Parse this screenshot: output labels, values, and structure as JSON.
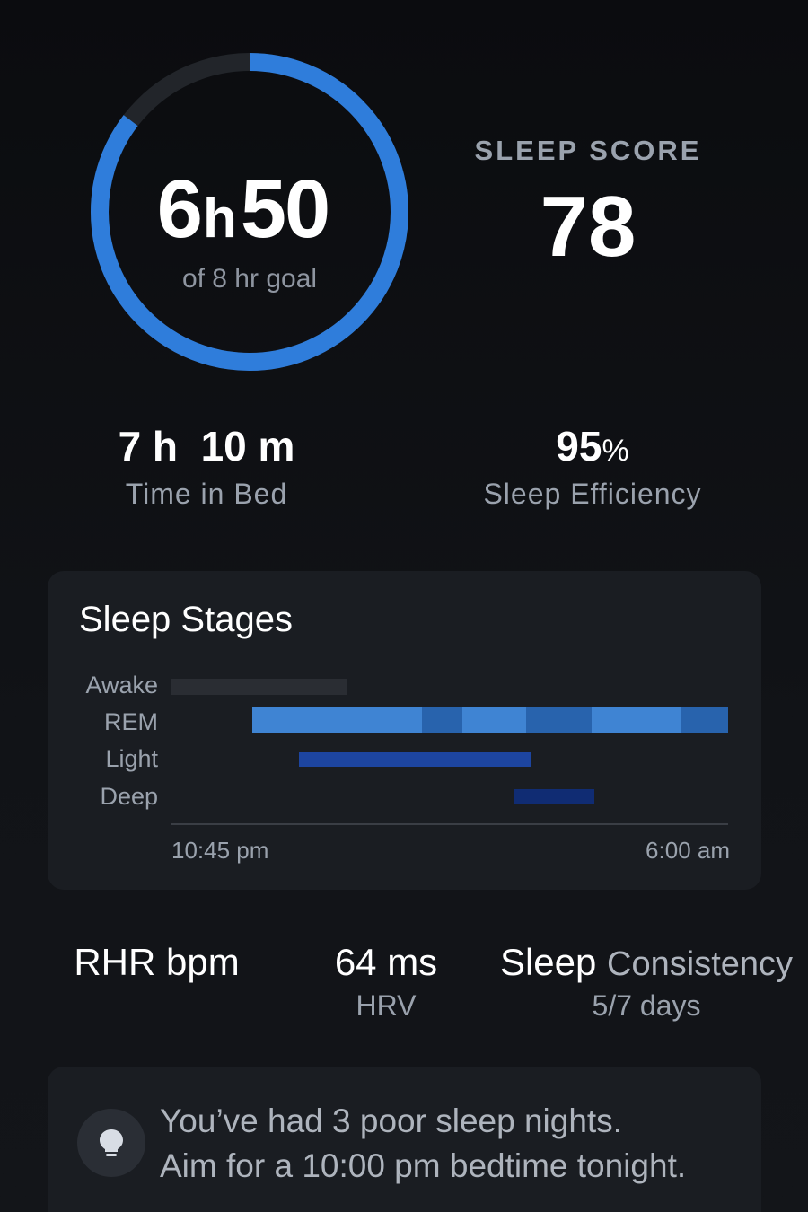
{
  "colors": {
    "accent": "#2f7ddb",
    "ring_track": "#22252a",
    "card_bg": "#1a1d22",
    "awake": "#2a2d33",
    "rem_light": "#3f84d3",
    "rem_dark": "#2863ad",
    "light": "#1d45a0",
    "deep": "#102c73"
  },
  "sleep_ring": {
    "hours": "6",
    "hours_unit": "h",
    "minutes": "50",
    "goal_text": "of 8 hr goal",
    "goal_progress": 0.854
  },
  "sleep_score": {
    "label": "SLEEP SCORE",
    "value": "78"
  },
  "time_in_bed": {
    "value": "7 h  10 m",
    "label": "Time in Bed"
  },
  "sleep_efficiency": {
    "value": "95",
    "unit": "%",
    "label": "Sleep Efficiency"
  },
  "stages_card": {
    "title": "Sleep Stages",
    "start_time": "10:45 pm",
    "end_time": "6:00 am",
    "labels": [
      "Awake",
      "REM",
      "Light",
      "Deep"
    ]
  },
  "chart_data": {
    "type": "timeline",
    "x_range": [
      "10:45 pm",
      "6:00 am"
    ],
    "stages": [
      {
        "name": "Awake",
        "segments": [
          [
            0.0,
            0.315
          ]
        ],
        "color": "#2a2d33"
      },
      {
        "name": "REM",
        "segments": [
          [
            0.145,
            0.45
          ],
          [
            0.45,
            0.522
          ],
          [
            0.522,
            0.637
          ],
          [
            0.637,
            0.755
          ],
          [
            0.755,
            0.915
          ],
          [
            0.915,
            1.0
          ]
        ],
        "shades": [
          "#3f84d3",
          "#2863ad",
          "#3f84d3",
          "#2863ad",
          "#3f84d3",
          "#2863ad"
        ]
      },
      {
        "name": "Light",
        "segments": [
          [
            0.229,
            0.647
          ]
        ],
        "color": "#1d45a0"
      },
      {
        "name": "Deep",
        "segments": [
          [
            0.615,
            0.76
          ]
        ],
        "color": "#102c73"
      }
    ]
  },
  "metrics": {
    "rhr": {
      "value": "RHR bpm"
    },
    "hrv": {
      "value": "64 ms",
      "label": "HRV"
    },
    "consistency": {
      "value_main": "Sleep",
      "value_soft": "Consistency",
      "label": "5/7 days"
    }
  },
  "tip": {
    "icon": "lightbulb-icon",
    "line1": "You’ve had 3 poor sleep nights.",
    "line2": "Aim for a 10:00 pm bedtime tonight."
  }
}
